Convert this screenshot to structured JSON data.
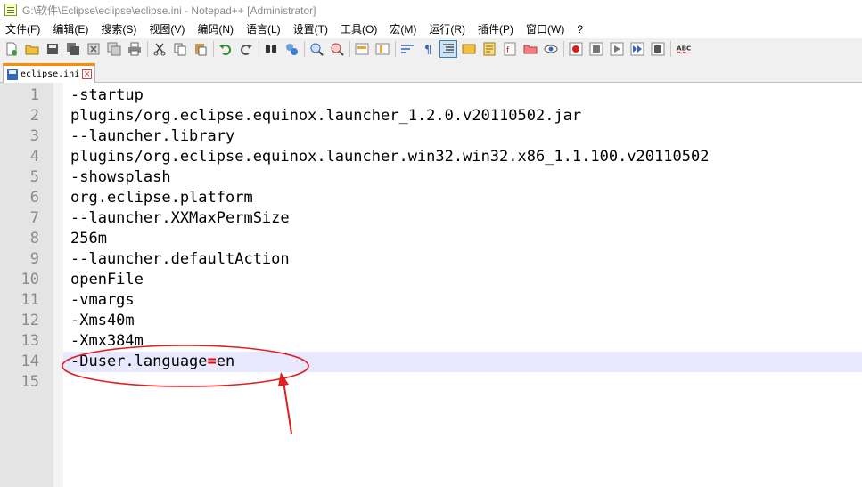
{
  "window": {
    "title": "G:\\软件\\Eclipse\\eclipse\\eclipse.ini - Notepad++ [Administrator]"
  },
  "menu": [
    "文件(F)",
    "编辑(E)",
    "搜索(S)",
    "视图(V)",
    "编码(N)",
    "语言(L)",
    "设置(T)",
    "工具(O)",
    "宏(M)",
    "运行(R)",
    "插件(P)",
    "窗口(W)",
    "?"
  ],
  "toolbar": {
    "icons": [
      "new-file-icon",
      "open-file-icon",
      "save-icon",
      "save-all-icon",
      "close-icon",
      "close-all-icon",
      "print-icon",
      "cut-icon",
      "copy-icon",
      "paste-icon",
      "undo-icon",
      "redo-icon",
      "find-icon",
      "replace-icon",
      "zoom-in-icon",
      "zoom-out-icon",
      "sync-vertical-icon",
      "sync-horizontal-icon",
      "word-wrap-icon",
      "show-all-chars-icon",
      "indent-guide-icon",
      "user-lang-icon",
      "doc-map-icon",
      "function-list-icon",
      "folder-workspace-icon",
      "monitor-icon",
      "record-macro-icon",
      "stop-macro-icon",
      "play-macro-icon",
      "play-macro-multiple-icon",
      "save-macro-icon",
      "spell-check-icon"
    ],
    "spell_check_label": "ABC"
  },
  "tabs": [
    {
      "label": "eclipse.ini",
      "active": true
    }
  ],
  "editor": {
    "current_line": 14,
    "lines": [
      {
        "n": "1",
        "text": "-startup"
      },
      {
        "n": "2",
        "text": "plugins/org.eclipse.equinox.launcher_1.2.0.v20110502.jar"
      },
      {
        "n": "3",
        "text": "--launcher.library"
      },
      {
        "n": "4",
        "text": "plugins/org.eclipse.equinox.launcher.win32.win32.x86_1.1.100.v20110502"
      },
      {
        "n": "5",
        "text": "-showsplash"
      },
      {
        "n": "6",
        "text": "org.eclipse.platform"
      },
      {
        "n": "7",
        "text": "--launcher.XXMaxPermSize"
      },
      {
        "n": "8",
        "text": "256m"
      },
      {
        "n": "9",
        "text": "--launcher.defaultAction"
      },
      {
        "n": "10",
        "text": "openFile"
      },
      {
        "n": "11",
        "text": "-vmargs"
      },
      {
        "n": "12",
        "text": "-Xms40m"
      },
      {
        "n": "13",
        "text": "-Xmx384m"
      },
      {
        "n": "14",
        "text_before": "-Duser.language",
        "text_eq": "=",
        "text_after": "en"
      },
      {
        "n": "15",
        "text": ""
      }
    ]
  },
  "colors": {
    "tab_accent": "#fa8c0a",
    "current_line": "#e8e8ff",
    "annotation": "#e02020"
  }
}
